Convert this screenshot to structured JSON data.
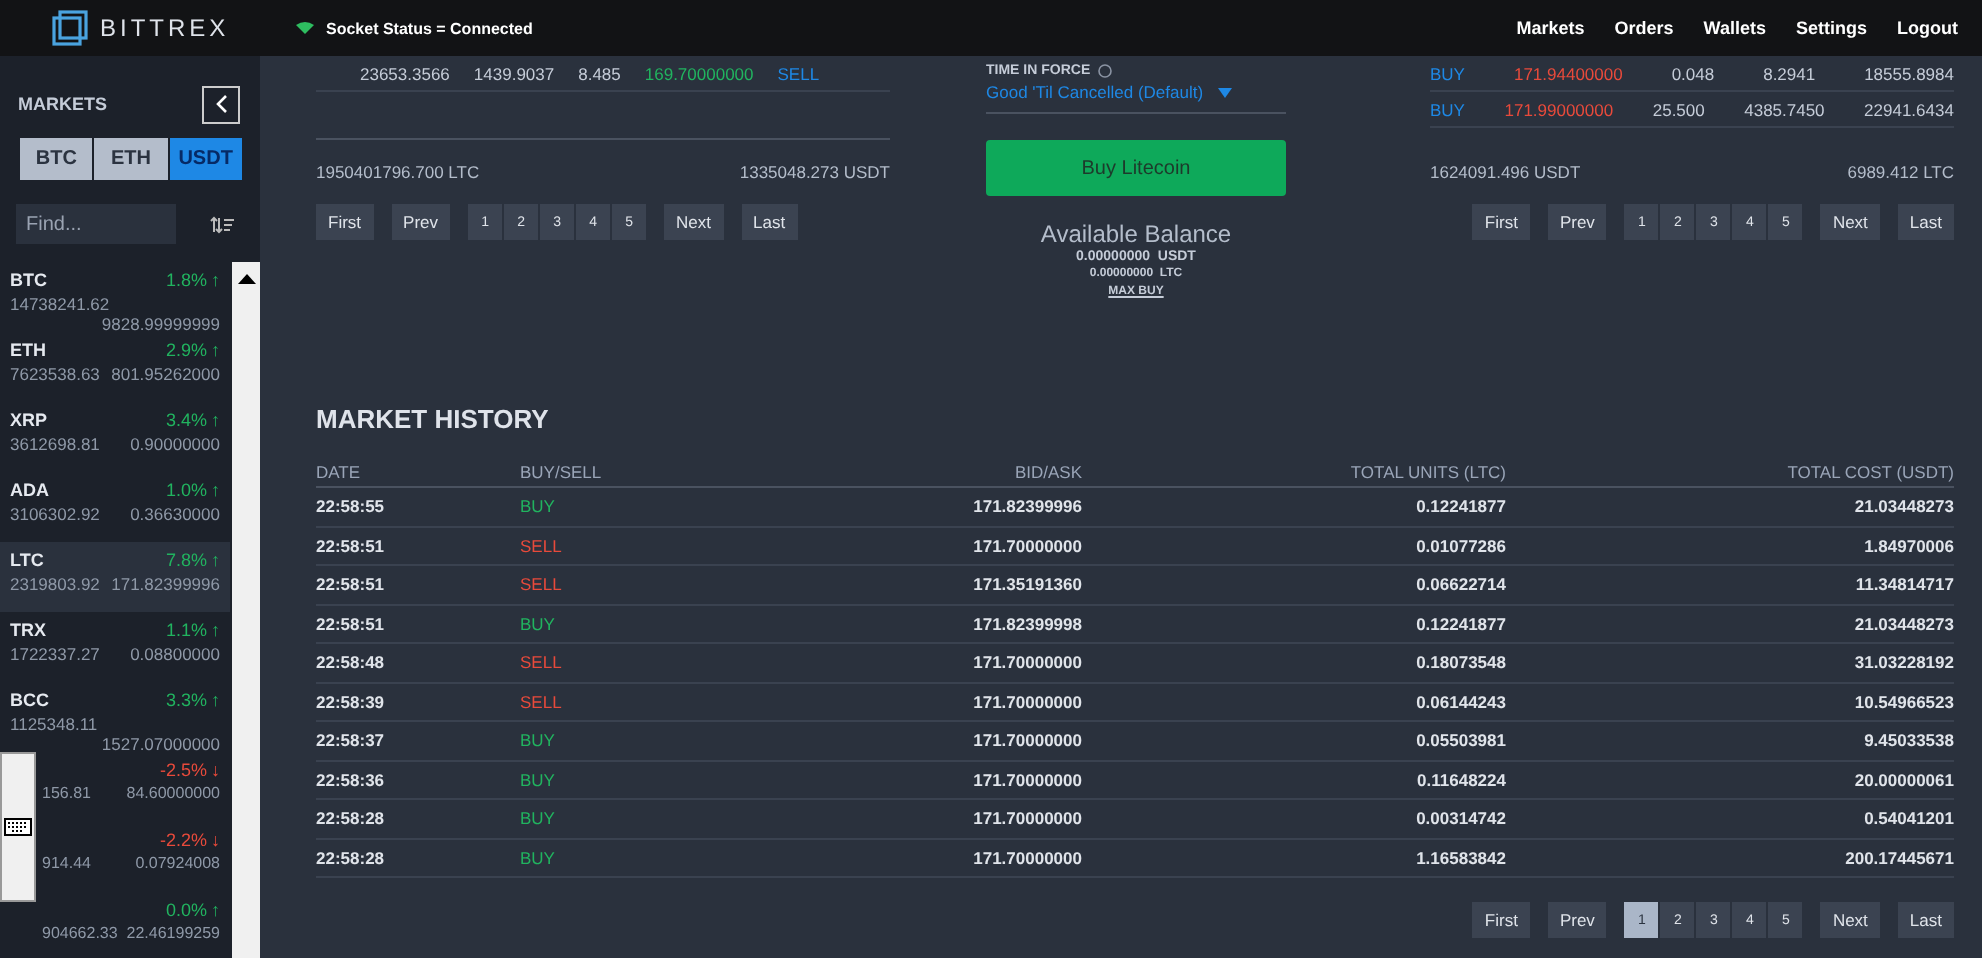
{
  "header": {
    "brand": "BITTREX",
    "socket_status": "Socket Status = Connected",
    "nav": [
      "Markets",
      "Orders",
      "Wallets",
      "Settings",
      "Logout"
    ]
  },
  "sidebar": {
    "title": "MARKETS",
    "tabs": [
      {
        "label": "BTC",
        "selected": false
      },
      {
        "label": "ETH",
        "selected": false
      },
      {
        "label": "USDT",
        "selected": true
      }
    ],
    "search": {
      "placeholder": "Find..."
    },
    "markets": [
      {
        "name": "BTC",
        "change": "1.8%",
        "arrow": "↑",
        "color": "#21b35f",
        "volume": "14738241.62",
        "price": "9828.99999999",
        "selected": false
      },
      {
        "name": "ETH",
        "change": "2.9%",
        "arrow": "↑",
        "color": "#21b35f",
        "volume": "7623538.63",
        "price": "801.95262000",
        "selected": false
      },
      {
        "name": "XRP",
        "change": "3.4%",
        "arrow": "↑",
        "color": "#21b35f",
        "volume": "3612698.81",
        "price": "0.90000000",
        "selected": false
      },
      {
        "name": "ADA",
        "change": "1.0%",
        "arrow": "↑",
        "color": "#21b35f",
        "volume": "3106302.92",
        "price": "0.36630000",
        "selected": false
      },
      {
        "name": "LTC",
        "change": "7.8%",
        "arrow": "↑",
        "color": "#21b35f",
        "volume": "2319803.92",
        "price": "171.82399996",
        "selected": true
      },
      {
        "name": "TRX",
        "change": "1.1%",
        "arrow": "↑",
        "color": "#21b35f",
        "volume": "1722337.27",
        "price": "0.08800000",
        "selected": false
      },
      {
        "name": "BCC",
        "change": "3.3%",
        "arrow": "↑",
        "color": "#21b35f",
        "volume": "1125348.11",
        "price": "1527.07000000",
        "selected": false
      },
      {
        "change": "-2.5%",
        "arrow": "↓",
        "color": "#e84a3b",
        "volume": "156.81",
        "price": "84.60000000",
        "selected": false
      },
      {
        "change": "-2.2%",
        "arrow": "↓",
        "color": "#e84a3b",
        "volume": "914.44",
        "price": "0.07924008",
        "selected": false
      },
      {
        "change": "0.0%",
        "arrow": "↑",
        "color": "#21b35f",
        "volume": "904662.33",
        "price": "22.46199259",
        "selected": false
      }
    ]
  },
  "books": [
    {
      "kind": "bid",
      "rows": [
        {
          "cells": [
            "23653.3566",
            "1439.9037",
            "8.485"
          ],
          "price": "169.70000000",
          "side": "SELL"
        }
      ],
      "total_1": "1950401796.700 LTC",
      "total_2": "1335048.273 USDT",
      "pagination": {
        "first": "First",
        "prev": "Prev",
        "pages": [
          {
            "label": "1",
            "selected": false
          },
          {
            "label": "2",
            "selected": false
          },
          {
            "label": "3",
            "selected": false
          },
          {
            "label": "4",
            "selected": false
          },
          {
            "label": "5",
            "selected": false
          }
        ],
        "next": "Next",
        "last": "Last"
      }
    },
    {
      "kind": "ask",
      "rows": [
        {
          "cells": [
            "0.048",
            "8.2941",
            "18555.8984"
          ],
          "price": "171.94400000",
          "side": "BUY"
        },
        {
          "cells": [
            "25.500",
            "4385.7450",
            "22941.6434"
          ],
          "price": "171.99000000",
          "side": "BUY"
        }
      ],
      "total_1": "1624091.496 USDT",
      "total_2": "6989.412 LTC",
      "pagination": {
        "first": "First",
        "prev": "Prev",
        "pages": [
          {
            "label": "1",
            "selected": false
          },
          {
            "label": "2",
            "selected": false
          },
          {
            "label": "3",
            "selected": false
          },
          {
            "label": "4",
            "selected": false
          },
          {
            "label": "5",
            "selected": false
          }
        ],
        "next": "Next",
        "last": "Last"
      }
    }
  ],
  "order_form": {
    "time_in_force_label": "TIME IN FORCE",
    "time_in_force_value": "Good 'Til Cancelled (Default)",
    "submit": "Buy Litecoin",
    "balance_title": "Available Balance",
    "balance_1": "0.00000000  USDT",
    "balance_2": "0.00000000  LTC",
    "max_buy": "MAX BUY"
  },
  "market_history": {
    "title": "MARKET HISTORY",
    "columns": [
      "DATE",
      "BUY/SELL",
      "BID/ASK",
      "TOTAL UNITS (LTC)",
      "TOTAL COST (USDT)"
    ],
    "rows": [
      {
        "date": "22:58:55",
        "type": "BUY",
        "kind": "buy",
        "bid_ask": "171.82399996",
        "units": "0.12241877",
        "cost": "21.03448273"
      },
      {
        "date": "22:58:51",
        "type": "SELL",
        "kind": "sell",
        "bid_ask": "171.70000000",
        "units": "0.01077286",
        "cost": "1.84970006"
      },
      {
        "date": "22:58:51",
        "type": "SELL",
        "kind": "sell",
        "bid_ask": "171.35191360",
        "units": "0.06622714",
        "cost": "11.34814717"
      },
      {
        "date": "22:58:51",
        "type": "BUY",
        "kind": "buy",
        "bid_ask": "171.82399998",
        "units": "0.12241877",
        "cost": "21.03448273"
      },
      {
        "date": "22:58:48",
        "type": "SELL",
        "kind": "sell",
        "bid_ask": "171.70000000",
        "units": "0.18073548",
        "cost": "31.03228192"
      },
      {
        "date": "22:58:39",
        "type": "SELL",
        "kind": "sell",
        "bid_ask": "171.70000000",
        "units": "0.06144243",
        "cost": "10.54966523"
      },
      {
        "date": "22:58:37",
        "type": "BUY",
        "kind": "buy",
        "bid_ask": "171.70000000",
        "units": "0.05503981",
        "cost": "9.45033538"
      },
      {
        "date": "22:58:36",
        "type": "BUY",
        "kind": "buy",
        "bid_ask": "171.70000000",
        "units": "0.11648224",
        "cost": "20.00000061"
      },
      {
        "date": "22:58:28",
        "type": "BUY",
        "kind": "buy",
        "bid_ask": "171.70000000",
        "units": "0.00314742",
        "cost": "0.54041201"
      },
      {
        "date": "22:58:28",
        "type": "BUY",
        "kind": "buy",
        "bid_ask": "171.70000000",
        "units": "1.16583842",
        "cost": "200.17445671"
      }
    ],
    "pagination": {
      "first": "First",
      "prev": "Prev",
      "pages": [
        {
          "label": "1",
          "selected": true
        },
        {
          "label": "2",
          "selected": false
        },
        {
          "label": "3",
          "selected": false
        },
        {
          "label": "4",
          "selected": false
        },
        {
          "label": "5",
          "selected": false
        }
      ],
      "next": "Next",
      "last": "Last"
    }
  }
}
